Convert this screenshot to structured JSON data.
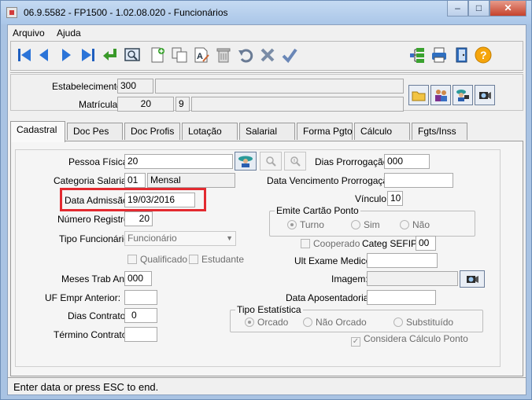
{
  "window": {
    "title": "06.9.5582 - FP1500 - 1.02.08.020 - Funcionários",
    "min_glyph": "–",
    "max_glyph": "□",
    "close_glyph": "✕"
  },
  "menu": {
    "items": [
      "Arquivo",
      "Ajuda"
    ]
  },
  "toolbar": {
    "icons": [
      "first-record-icon",
      "previous-record-icon",
      "next-record-icon",
      "last-record-icon",
      "goto-icon",
      "search-icon",
      "new-record-icon",
      "copy-icon",
      "edit-icon",
      "delete-icon",
      "undo-icon",
      "cancel-icon",
      "confirm-icon",
      "tree-icon",
      "print-icon",
      "exit-icon",
      "help-icon"
    ]
  },
  "header": {
    "estabelecimento_label": "Estabelecimento:",
    "estabelecimento_value": "300",
    "estabelecimento_desc": "",
    "matricula_label": "Matrícula:",
    "matricula_value": "20",
    "matricula_digit": "9",
    "matricula_name": ""
  },
  "tabs": [
    "Cadastral",
    "Doc Pes",
    "Doc Profis",
    "Lotação",
    "Salarial",
    "Forma Pgto",
    "Cálculo",
    "Fgts/Inss"
  ],
  "form": {
    "pessoa_fisica_label": "Pessoa Física:",
    "pessoa_fisica_value": "20",
    "dias_prorrogacao_label": "Dias Prorrogação:",
    "dias_prorrogacao_value": "000",
    "categoria_label": "Categoria Salarial:",
    "categoria_code": "01",
    "categoria_desc": "Mensal",
    "dias_venc_label": "Data Vencimento Prorrogação:",
    "dias_venc_value": "",
    "data_admissao_label": "Data Admissão:",
    "data_admissao_value": "19/03/2016",
    "vinculo_label": "Vínculo:",
    "vinculo_value": "10",
    "numero_registro_label": "Número Registro:",
    "numero_registro_value": "20",
    "emite_cartao_label": "Emite Cartão Ponto",
    "emite_opts": [
      "Turno",
      "Sim",
      "Não"
    ],
    "tipo_func_label": "Tipo Funcionário:",
    "tipo_func_value": "Funcionário",
    "cooperado_label": "Cooperado",
    "categ_sefip_label": "Categ SEFIP:",
    "categ_sefip_value": "00",
    "qualificado_label": "Qualificado",
    "estudante_label": "Estudante",
    "ult_exame_label": "Ult Exame Medico:",
    "ult_exame_value": "",
    "meses_trab_label": "Meses Trab Ant:",
    "meses_trab_value": "000",
    "imagem_label": "Imagem:",
    "imagem_value": "",
    "uf_empr_label": "UF Empr Anterior:",
    "uf_empr_value": "",
    "data_apos_label": "Data Aposentadoria:",
    "data_apos_value": "",
    "dias_contrato_label": "Dias Contrato:",
    "dias_contrato_value": "0",
    "tipo_estat_label": "Tipo Estatística",
    "tipo_estat_opts": [
      "Orcado",
      "Não Orcado",
      "Substituído"
    ],
    "termino_label": "Término Contrato:",
    "termino_value": "",
    "considera_label": "Considera Cálculo Ponto"
  },
  "status": {
    "text": "Enter data or press ESC to end."
  }
}
